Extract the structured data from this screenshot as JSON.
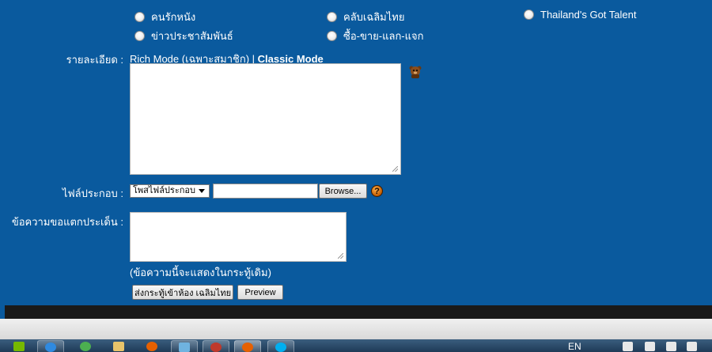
{
  "categories": {
    "row1": [
      "คนรักหนัง",
      "คลับเฉลิมไทย",
      "Thailand's Got Talent"
    ],
    "row2": [
      "ข่าวประชาสัมพันธ์",
      "ซื้อ-ขาย-แลก-แจก"
    ]
  },
  "detail": {
    "label": "รายละเอียด :",
    "rich_mode": "Rich Mode (เฉพาะสมาชิก)",
    "separator": " | ",
    "classic_mode": "Classic Mode"
  },
  "attachment": {
    "label": "ไฟล์ประกอบ :",
    "select_value": "โพสไฟล์ประกอบ",
    "browse": "Browse...",
    "help": "?"
  },
  "objection": {
    "label": "ข้อความขอแตกประเด็น :",
    "note": "(ข้อความนี้จะแสดงในกระทู้เดิม)"
  },
  "buttons": {
    "submit": "ส่งกระทู้เข้าห้อง เฉลิมไทย",
    "preview": "Preview"
  },
  "taskbar": {
    "language": "EN",
    "apps": [
      "nvidia-icon",
      "ie-icon",
      "music-player-icon",
      "folder-icon",
      "firefox-icon",
      "network-icon",
      "acrobat-icon",
      "firefox-active-icon",
      "skype-icon"
    ]
  },
  "colors": {
    "page_bg": "#0a5a9e"
  }
}
